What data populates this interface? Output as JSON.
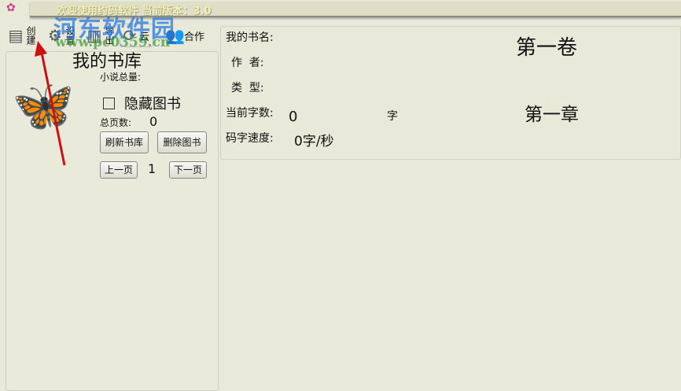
{
  "title": "欢迎使用约码软件  当前版本：3.0",
  "watermark": {
    "name": "河东软件园",
    "url": "www.pc0359.cn"
  },
  "toolbar": [
    {
      "label": "创建",
      "icon": "book-icon"
    },
    {
      "label": "设置",
      "icon": "gear-icon"
    },
    {
      "label": "导出",
      "icon": "export-icon"
    },
    {
      "label": "云",
      "icon": "cloud-sync-icon"
    },
    {
      "label": "合作",
      "icon": "people-icon"
    }
  ],
  "library": {
    "title": "我的书库",
    "novel_total_label": "小说总量:",
    "hide_books_label": "隐藏图书",
    "total_pages_label": "总页数:",
    "total_pages": "0",
    "refresh_label": "刷新书库",
    "delete_label": "删除图书",
    "prev_label": "上一页",
    "page": "1",
    "next_label": "下一页"
  },
  "info": {
    "book_name_label": "我的书名:",
    "author_label": "作  者:",
    "type_label": "类  型:",
    "word_count_label": "当前字数:",
    "word_count": "0",
    "word_unit": "字",
    "speed_label": "码字速度:",
    "speed": "0字/秒",
    "volume": "第一卷",
    "chapter": "第一章"
  }
}
